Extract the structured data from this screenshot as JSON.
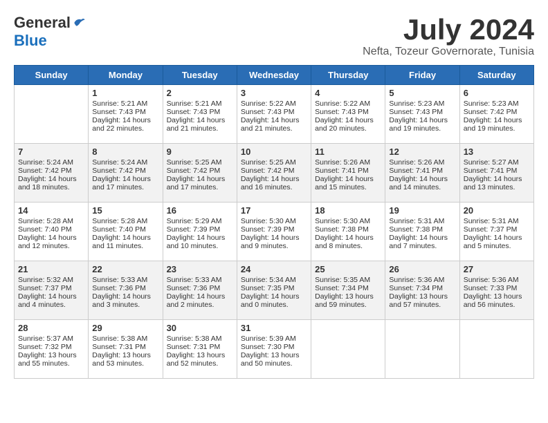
{
  "logo": {
    "general": "General",
    "blue": "Blue"
  },
  "title": {
    "month_year": "July 2024",
    "location": "Nefta, Tozeur Governorate, Tunisia"
  },
  "days_of_week": [
    "Sunday",
    "Monday",
    "Tuesday",
    "Wednesday",
    "Thursday",
    "Friday",
    "Saturday"
  ],
  "weeks": [
    [
      {
        "day": "",
        "content": ""
      },
      {
        "day": "1",
        "content": "Sunrise: 5:21 AM\nSunset: 7:43 PM\nDaylight: 14 hours\nand 22 minutes."
      },
      {
        "day": "2",
        "content": "Sunrise: 5:21 AM\nSunset: 7:43 PM\nDaylight: 14 hours\nand 21 minutes."
      },
      {
        "day": "3",
        "content": "Sunrise: 5:22 AM\nSunset: 7:43 PM\nDaylight: 14 hours\nand 21 minutes."
      },
      {
        "day": "4",
        "content": "Sunrise: 5:22 AM\nSunset: 7:43 PM\nDaylight: 14 hours\nand 20 minutes."
      },
      {
        "day": "5",
        "content": "Sunrise: 5:23 AM\nSunset: 7:43 PM\nDaylight: 14 hours\nand 19 minutes."
      },
      {
        "day": "6",
        "content": "Sunrise: 5:23 AM\nSunset: 7:42 PM\nDaylight: 14 hours\nand 19 minutes."
      }
    ],
    [
      {
        "day": "7",
        "content": "Sunrise: 5:24 AM\nSunset: 7:42 PM\nDaylight: 14 hours\nand 18 minutes."
      },
      {
        "day": "8",
        "content": "Sunrise: 5:24 AM\nSunset: 7:42 PM\nDaylight: 14 hours\nand 17 minutes."
      },
      {
        "day": "9",
        "content": "Sunrise: 5:25 AM\nSunset: 7:42 PM\nDaylight: 14 hours\nand 17 minutes."
      },
      {
        "day": "10",
        "content": "Sunrise: 5:25 AM\nSunset: 7:42 PM\nDaylight: 14 hours\nand 16 minutes."
      },
      {
        "day": "11",
        "content": "Sunrise: 5:26 AM\nSunset: 7:41 PM\nDaylight: 14 hours\nand 15 minutes."
      },
      {
        "day": "12",
        "content": "Sunrise: 5:26 AM\nSunset: 7:41 PM\nDaylight: 14 hours\nand 14 minutes."
      },
      {
        "day": "13",
        "content": "Sunrise: 5:27 AM\nSunset: 7:41 PM\nDaylight: 14 hours\nand 13 minutes."
      }
    ],
    [
      {
        "day": "14",
        "content": "Sunrise: 5:28 AM\nSunset: 7:40 PM\nDaylight: 14 hours\nand 12 minutes."
      },
      {
        "day": "15",
        "content": "Sunrise: 5:28 AM\nSunset: 7:40 PM\nDaylight: 14 hours\nand 11 minutes."
      },
      {
        "day": "16",
        "content": "Sunrise: 5:29 AM\nSunset: 7:39 PM\nDaylight: 14 hours\nand 10 minutes."
      },
      {
        "day": "17",
        "content": "Sunrise: 5:30 AM\nSunset: 7:39 PM\nDaylight: 14 hours\nand 9 minutes."
      },
      {
        "day": "18",
        "content": "Sunrise: 5:30 AM\nSunset: 7:38 PM\nDaylight: 14 hours\nand 8 minutes."
      },
      {
        "day": "19",
        "content": "Sunrise: 5:31 AM\nSunset: 7:38 PM\nDaylight: 14 hours\nand 7 minutes."
      },
      {
        "day": "20",
        "content": "Sunrise: 5:31 AM\nSunset: 7:37 PM\nDaylight: 14 hours\nand 5 minutes."
      }
    ],
    [
      {
        "day": "21",
        "content": "Sunrise: 5:32 AM\nSunset: 7:37 PM\nDaylight: 14 hours\nand 4 minutes."
      },
      {
        "day": "22",
        "content": "Sunrise: 5:33 AM\nSunset: 7:36 PM\nDaylight: 14 hours\nand 3 minutes."
      },
      {
        "day": "23",
        "content": "Sunrise: 5:33 AM\nSunset: 7:36 PM\nDaylight: 14 hours\nand 2 minutes."
      },
      {
        "day": "24",
        "content": "Sunrise: 5:34 AM\nSunset: 7:35 PM\nDaylight: 14 hours\nand 0 minutes."
      },
      {
        "day": "25",
        "content": "Sunrise: 5:35 AM\nSunset: 7:34 PM\nDaylight: 13 hours\nand 59 minutes."
      },
      {
        "day": "26",
        "content": "Sunrise: 5:36 AM\nSunset: 7:34 PM\nDaylight: 13 hours\nand 57 minutes."
      },
      {
        "day": "27",
        "content": "Sunrise: 5:36 AM\nSunset: 7:33 PM\nDaylight: 13 hours\nand 56 minutes."
      }
    ],
    [
      {
        "day": "28",
        "content": "Sunrise: 5:37 AM\nSunset: 7:32 PM\nDaylight: 13 hours\nand 55 minutes."
      },
      {
        "day": "29",
        "content": "Sunrise: 5:38 AM\nSunset: 7:31 PM\nDaylight: 13 hours\nand 53 minutes."
      },
      {
        "day": "30",
        "content": "Sunrise: 5:38 AM\nSunset: 7:31 PM\nDaylight: 13 hours\nand 52 minutes."
      },
      {
        "day": "31",
        "content": "Sunrise: 5:39 AM\nSunset: 7:30 PM\nDaylight: 13 hours\nand 50 minutes."
      },
      {
        "day": "",
        "content": ""
      },
      {
        "day": "",
        "content": ""
      },
      {
        "day": "",
        "content": ""
      }
    ]
  ]
}
